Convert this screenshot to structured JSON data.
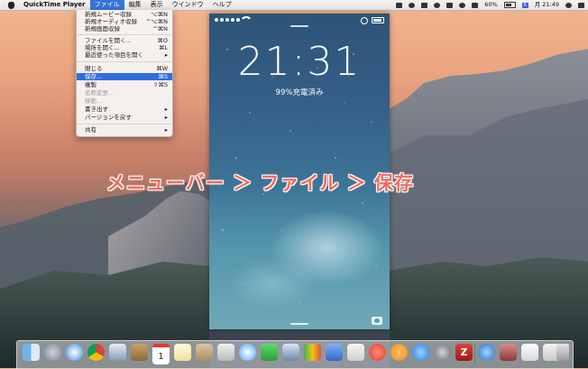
{
  "menubar": {
    "app_name": "QuickTime Player",
    "menus": [
      "ファイル",
      "編集",
      "表示",
      "ウインドウ",
      "ヘルプ"
    ],
    "active_menu": "ファイル",
    "battery": "60%",
    "clock": "月 21:49"
  },
  "file_menu": {
    "items": [
      {
        "label": "新規ムービー収録",
        "shortcut": "⌥⌘N",
        "state": "enabled"
      },
      {
        "label": "新規オーディオ収録",
        "shortcut": "^⌥⌘N",
        "state": "enabled"
      },
      {
        "label": "新規画面収録",
        "shortcut": "^⌘N",
        "state": "enabled"
      },
      {
        "label": "ファイルを開く...",
        "shortcut": "⌘O",
        "state": "enabled"
      },
      {
        "label": "場所を開く...",
        "shortcut": "⌘L",
        "state": "enabled"
      },
      {
        "label": "最近使った項目を開く",
        "shortcut": "▸",
        "state": "enabled"
      },
      {
        "label": "閉じる",
        "shortcut": "⌘W",
        "state": "enabled"
      },
      {
        "label": "保存...",
        "shortcut": "⌘S",
        "state": "highlighted"
      },
      {
        "label": "複製",
        "shortcut": "⇧⌘S",
        "state": "enabled"
      },
      {
        "label": "名称変更...",
        "shortcut": "",
        "state": "disabled"
      },
      {
        "label": "移動...",
        "shortcut": "",
        "state": "disabled"
      },
      {
        "label": "書き出す",
        "shortcut": "▸",
        "state": "enabled"
      },
      {
        "label": "バージョンを戻す",
        "shortcut": "▸",
        "state": "enabled"
      },
      {
        "label": "共有",
        "shortcut": "▸",
        "state": "enabled"
      }
    ]
  },
  "phone": {
    "time": "21:31",
    "charge_text": "99%充電済み"
  },
  "annotation": "メニューバー ＞ ファイル ＞ 保存",
  "dock": {
    "icons": [
      "finder-icon",
      "launchpad-icon",
      "safari-icon",
      "chrome-icon",
      "preview-icon",
      "calendar-icon",
      "notes-icon",
      "contacts-icon",
      "photos-icon",
      "messages-icon",
      "facetime-icon",
      "numbers-icon",
      "keynote-icon",
      "pages-icon",
      "script-icon",
      "music-icon",
      "ibooks-icon",
      "appstore-icon",
      "settings-icon",
      "filezilla-icon",
      "quicktime-icon",
      "folder-icon",
      "document-icon",
      "download-icon",
      "trash-icon"
    ],
    "calendar_day": "1"
  },
  "colors": {
    "menu_highlight": "#2f6ee0",
    "annotation": "#f26a5e"
  }
}
